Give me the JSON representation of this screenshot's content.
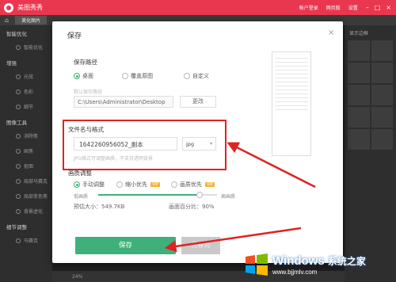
{
  "app": {
    "title": "美图秀秀",
    "tab": "美化图片",
    "header_links": [
      "帐户登录",
      "网页版",
      "设置"
    ]
  },
  "left_panel": {
    "sections": [
      {
        "title": "智能优化",
        "items": [
          "智能优化"
        ]
      },
      {
        "title": "增强",
        "items": [
          "光效",
          "色彩",
          "细节"
        ]
      },
      {
        "title": "图像工具",
        "items": [
          "消除笔",
          "画笔",
          "抠图",
          "局部马赛克",
          "局部变色笔",
          "背景虚化"
        ]
      },
      {
        "title": "细节调整",
        "items": [
          "马赛克"
        ]
      }
    ]
  },
  "right_panel": {
    "label": "显示边框"
  },
  "bottom_bar": {
    "zoom": "24%"
  },
  "dialog": {
    "title": "保存",
    "close_icon": "×",
    "path_section": {
      "label": "保存路径",
      "options": [
        "桌面",
        "覆盖原图",
        "自定义"
      ],
      "selected": "桌面",
      "default_hint": "默认保存路径",
      "path_value": "C:\\Users\\Administrator\\Desktop",
      "change_label": "更改"
    },
    "name_section": {
      "label": "文件名与格式",
      "filename": "1642260956052_副本",
      "format": "jpg",
      "hint": "JPG格式可调整画质，不支持透明背景"
    },
    "quality_section": {
      "label": "画质调整",
      "options": [
        {
          "label": "手动调整",
          "vip": false
        },
        {
          "label": "缩小优先",
          "vip": true
        },
        {
          "label": "画质优先",
          "vip": true
        }
      ],
      "selected": "手动调整",
      "vip_badge": "VIP",
      "slider_low": "低画质",
      "slider_high": "高画质",
      "slider_value": 0.85,
      "estimated_size_label": "预估大小：",
      "estimated_size": "549.7KB",
      "quality_percent_label": "画面百分比：",
      "quality_percent": "90%"
    },
    "save_label": "保存",
    "save_as_label": "另存为"
  },
  "watermark": {
    "title": "Windows",
    "title_cn": "系统之家",
    "url": "www.bjjmlv.com"
  },
  "colors": {
    "brand": "#e8374f",
    "accent": "#3fb07a",
    "highlight": "#e02222"
  }
}
